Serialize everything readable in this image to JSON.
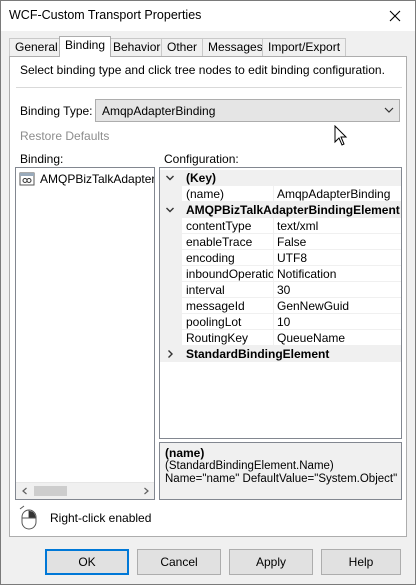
{
  "window": {
    "title": "WCF-Custom Transport Properties"
  },
  "tabs": [
    {
      "label": "General"
    },
    {
      "label": "Binding"
    },
    {
      "label": "Behavior"
    },
    {
      "label": "Other"
    },
    {
      "label": "Messages"
    },
    {
      "label": "Import/Export"
    }
  ],
  "active_tab": "Binding",
  "instruction": "Select binding type and click tree nodes to edit binding configuration.",
  "binding_type": {
    "label": "Binding Type:",
    "value": "AmqpAdapterBinding"
  },
  "restore_defaults": "Restore Defaults",
  "binding_panel": {
    "label": "Binding:",
    "items": [
      {
        "label": "AMQPBizTalkAdapterBindingElement",
        "icon": "binding-element-icon"
      }
    ]
  },
  "config_panel": {
    "label": "Configuration:",
    "categories": [
      {
        "label": "(Key)",
        "expanded": true,
        "properties": [
          {
            "name": "(name)",
            "value": "AmqpAdapterBinding"
          }
        ]
      },
      {
        "label": "AMQPBizTalkAdapterBindingElement",
        "expanded": true,
        "properties": [
          {
            "name": "contentType",
            "value": "text/xml"
          },
          {
            "name": "enableTrace",
            "value": "False"
          },
          {
            "name": "encoding",
            "value": "UTF8"
          },
          {
            "name": "inboundOperationType",
            "value": "Notification"
          },
          {
            "name": "interval",
            "value": "30"
          },
          {
            "name": "messageId",
            "value": "GenNewGuid"
          },
          {
            "name": "poolingLot",
            "value": "10"
          },
          {
            "name": "RoutingKey",
            "value": "QueueName"
          }
        ]
      },
      {
        "label": "StandardBindingElement",
        "expanded": false,
        "properties": []
      }
    ]
  },
  "description": {
    "title": "(name)",
    "line1": "(StandardBindingElement.Name)",
    "line2": "Name=\"name\" DefaultValue=\"System.Object\" ..."
  },
  "right_click_label": "Right-click enabled",
  "buttons": {
    "ok": "OK",
    "cancel": "Cancel",
    "apply": "Apply",
    "help": "Help"
  },
  "colors": {
    "accent": "#0078d7",
    "dialog_bg": "#f0f0f0",
    "disabled_text": "#8d8d8d",
    "border": "#adadad"
  }
}
